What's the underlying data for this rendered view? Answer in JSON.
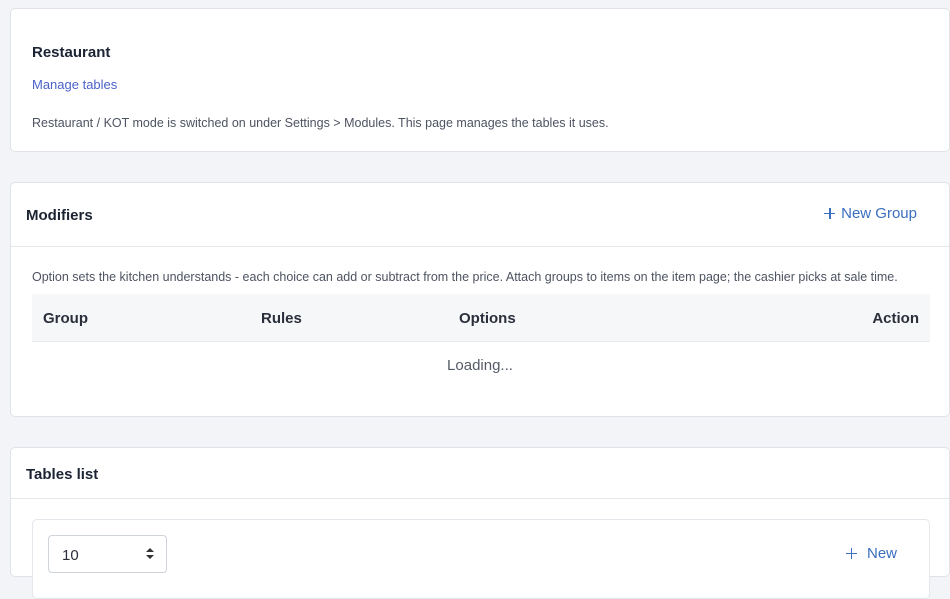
{
  "restaurant": {
    "title": "Restaurant",
    "link_label": "Manage tables",
    "description": "Restaurant / KOT mode is switched on under Settings > Modules. This page manages the tables it uses."
  },
  "modifiers": {
    "title": "Modifiers",
    "new_group_label": "New Group",
    "description": "Option sets the kitchen understands - each choice can add or subtract from the price. Attach groups to items on the item page; the cashier picks at sale time.",
    "columns": [
      "Group",
      "Rules",
      "Options",
      "Action"
    ],
    "loading_text": "Loading..."
  },
  "tables_list": {
    "title": "Tables list",
    "page_size": "10",
    "new_label": "New"
  },
  "colors": {
    "accent": "#3a6ebf",
    "link": "#4b62c9",
    "background": "#f3f4f7"
  },
  "icons": {
    "add": "plus-icon",
    "select": "updown-icon"
  }
}
